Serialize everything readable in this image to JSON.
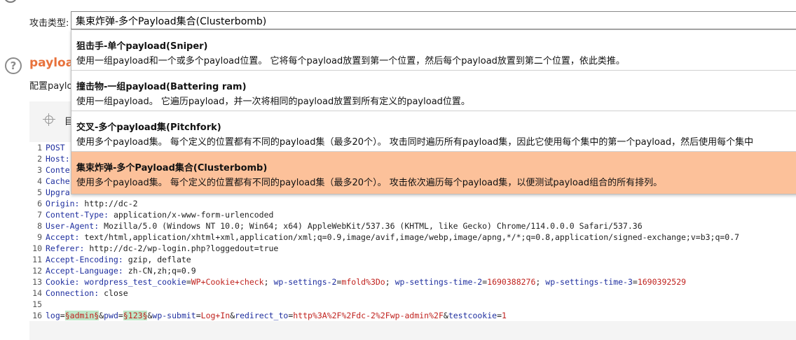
{
  "attack_type": {
    "label": "攻击类型:",
    "selected_value": "集束炸弹-多个Payload集合(Clusterbomb)"
  },
  "options": [
    {
      "title": "狙击手-单个payload(Sniper)",
      "desc": "使用一组payload和一个或多个payload位置。 它将每个payload放置到第一个位置，然后每个payload放置到第二个位置，依此类推。",
      "selected": false
    },
    {
      "title": "撞击物-一组payload(Battering ram)",
      "desc": "使用一组payload。 它遍历payload，并一次将相同的payload放置到所有定义的payload位置。",
      "selected": false
    },
    {
      "title": "交叉-多个payload集(Pitchfork)",
      "desc": "使用多个payload集。 每个定义的位置都有不同的payload集（最多20个）。 攻击同时遍历所有payload集，因此它使用每个集中的第一个payload，然后使用每个集中",
      "selected": false
    },
    {
      "title": "集束炸弹-多个Payload集合(Clusterbomb)",
      "desc": "使用多个payload集。 每个定义的位置都有不同的payload集（最多20个）。 攻击依次遍历每个payload集，以便测试payload组合的所有排列。",
      "selected": true
    }
  ],
  "section": {
    "heading": "payload",
    "config_text": "配置paylo"
  },
  "editor": {
    "target_label": "目",
    "lines": [
      {
        "n": "1",
        "key": "POST",
        "value": ""
      },
      {
        "n": "2",
        "key": "Host:",
        "value": ""
      },
      {
        "n": "3",
        "key": "Conte",
        "value": ""
      },
      {
        "n": "4",
        "key": "Cache",
        "value": ""
      },
      {
        "n": "5",
        "key": "Upgra",
        "value": ""
      },
      {
        "n": "6",
        "key": "Origin:",
        "value": " http://dc-2"
      },
      {
        "n": "7",
        "key": "Content-Type:",
        "value": " application/x-www-form-urlencoded"
      },
      {
        "n": "8",
        "key": "User-Agent:",
        "value": " Mozilla/5.0 (Windows NT 10.0; Win64; x64) AppleWebKit/537.36 (KHTML, like Gecko) Chrome/114.0.0.0 Safari/537.36"
      },
      {
        "n": "9",
        "key": "Accept:",
        "value": " text/html,application/xhtml+xml,application/xml;q=0.9,image/avif,image/webp,image/apng,*/*;q=0.8,application/signed-exchange;v=b3;q=0.7"
      },
      {
        "n": "10",
        "key": "Referer:",
        "value": " http://dc-2/wp-login.php?loggedout=true"
      },
      {
        "n": "11",
        "key": "Accept-Encoding:",
        "value": " gzip, deflate"
      },
      {
        "n": "12",
        "key": "Accept-Language:",
        "value": " zh-CN,zh;q=0.9"
      }
    ],
    "cookie_line": {
      "n": "13",
      "key": "Cookie:",
      "wp_test_name": "wordpress_test_cookie",
      "wp_test_val": "WP+Cookie+check",
      "s2_name": "wp-settings-2",
      "s2_val": "mfold%3Do",
      "t2_name": "wp-settings-time-2",
      "t2_val": "1690388276",
      "t3_name": "wp-settings-time-3",
      "t3_val": "1690392529"
    },
    "connection_line": {
      "n": "14",
      "key": "Connection:",
      "value": " close"
    },
    "empty_line": {
      "n": "15"
    },
    "body_line": {
      "n": "16",
      "log_name": "log",
      "log_marker": "§admin§",
      "pwd_name": "pwd",
      "pwd_marker": "§123§",
      "submit_name": "wp-submit",
      "submit_val": "Log+In",
      "redirect_name": "redirect_to",
      "redirect_val": "http%3A%2F%2Fdc-2%2Fwp-admin%2F",
      "testcookie_name": "testcookie",
      "testcookie_val": "1"
    }
  }
}
